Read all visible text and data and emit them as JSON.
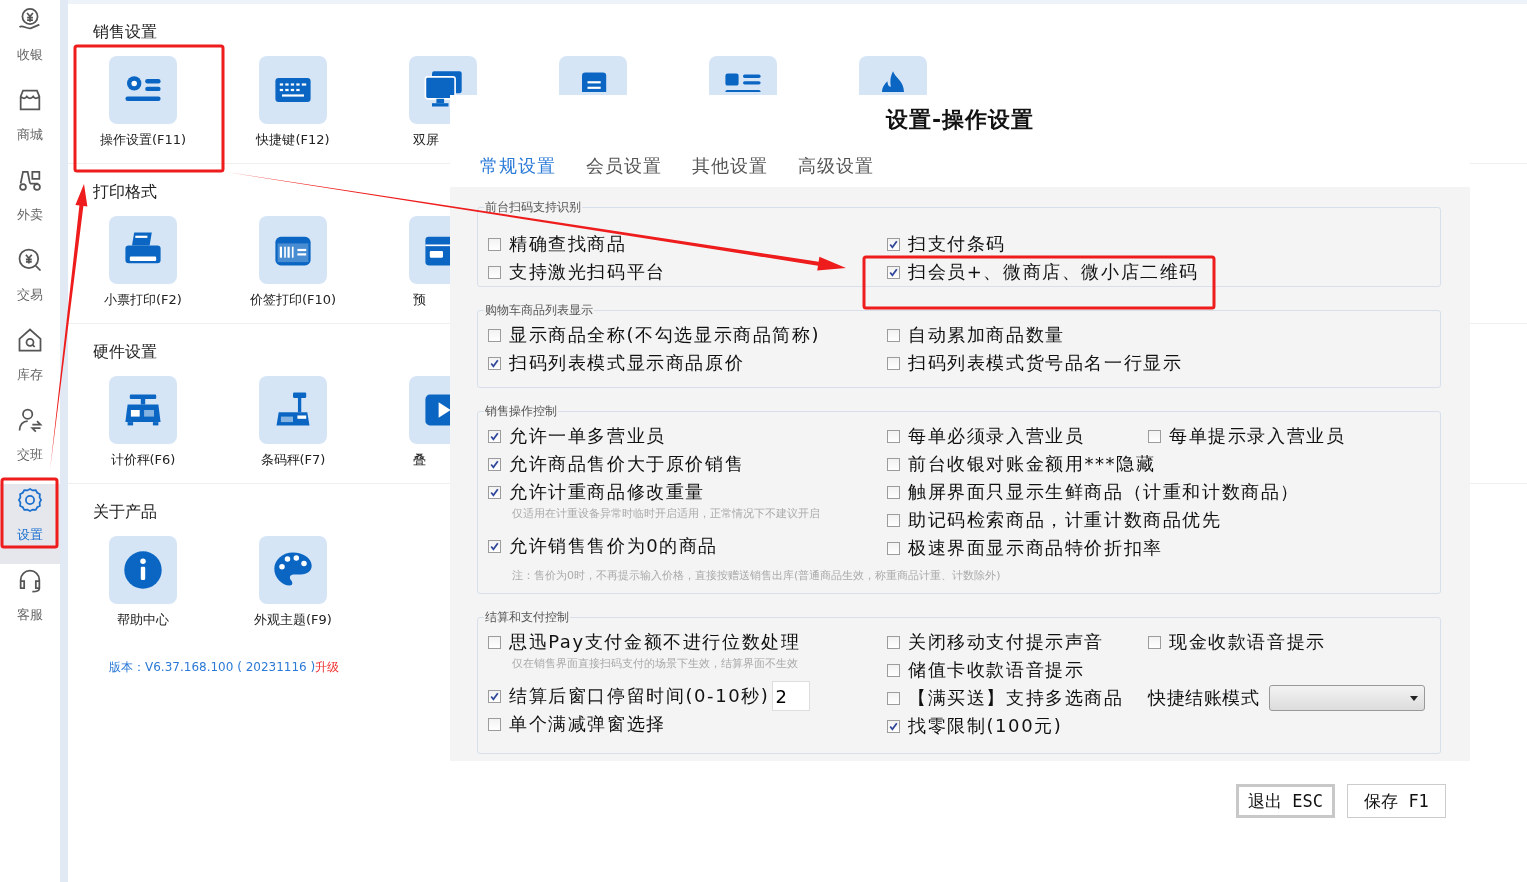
{
  "sidebar": {
    "items": [
      {
        "label": "收银",
        "selected": false
      },
      {
        "label": "商城",
        "selected": false
      },
      {
        "label": "外卖",
        "selected": false
      },
      {
        "label": "交易",
        "selected": false
      },
      {
        "label": "库存",
        "selected": false
      },
      {
        "label": "交班",
        "selected": false
      },
      {
        "label": "设置",
        "selected": true
      },
      {
        "label": "客服",
        "selected": false
      }
    ]
  },
  "sections": [
    {
      "title": "销售设置",
      "tiles": [
        {
          "kind": "labelled",
          "label": "操作设置(F11)"
        },
        {
          "kind": "labelled",
          "label": "快捷键(F12)"
        },
        {
          "kind": "labelled",
          "label": "双屏",
          "cut": true
        },
        {
          "kind": "covered"
        },
        {
          "kind": "covered"
        },
        {
          "kind": "covered"
        }
      ]
    },
    {
      "title": "打印格式",
      "tiles": [
        {
          "kind": "labelled",
          "label": "小票打印(F2)"
        },
        {
          "kind": "labelled",
          "label": "价签打印(F10)"
        },
        {
          "kind": "labelled",
          "label": "预",
          "cut": true
        }
      ]
    },
    {
      "title": "硬件设置",
      "tiles": [
        {
          "kind": "labelled",
          "label": "计价秤(F6)"
        },
        {
          "kind": "labelled",
          "label": "条码秤(F7)"
        },
        {
          "kind": "labelled",
          "label": "叠",
          "cut": true
        }
      ]
    },
    {
      "title": "关于产品",
      "tiles": [
        {
          "kind": "labelled",
          "label": "帮助中心"
        },
        {
          "kind": "labelled",
          "label": "外观主题(F9)"
        }
      ]
    }
  ],
  "version": {
    "text": "版本：V6.37.168.100 ( 20231116 )",
    "link": "升级"
  },
  "dialog": {
    "title": "设置-操作设置",
    "tabs": [
      {
        "label": "常规设置",
        "selected": true
      },
      {
        "label": "会员设置",
        "selected": false
      },
      {
        "label": "其他设置",
        "selected": false
      },
      {
        "label": "高级设置",
        "selected": false
      }
    ],
    "groups": [
      {
        "legend": "前台扫码支持识别",
        "left": [
          {
            "kind": "options",
            "items": [
              {
                "kind": "checkbox",
                "label": "精确查找商品",
                "checked": false
              }
            ]
          },
          {
            "kind": "options",
            "items": [
              {
                "kind": "checkbox",
                "label": "支持激光扫码平台",
                "checked": false
              }
            ]
          }
        ],
        "right": [
          {
            "kind": "options",
            "items": [
              {
                "kind": "checkbox",
                "label": "扫支付条码",
                "checked": true
              }
            ]
          },
          {
            "kind": "options",
            "items": [
              {
                "kind": "checkbox",
                "label": "扫会员+、微商店、微小店二维码",
                "checked": true
              }
            ]
          }
        ]
      },
      {
        "legend": "购物车商品列表显示",
        "left": [
          {
            "kind": "options",
            "items": [
              {
                "kind": "checkbox",
                "label": "显示商品全称(不勾选显示商品简称)",
                "checked": false
              }
            ]
          },
          {
            "kind": "options",
            "items": [
              {
                "kind": "checkbox",
                "label": "扫码列表模式显示商品原价",
                "checked": true
              }
            ]
          }
        ],
        "right": [
          {
            "kind": "options",
            "items": [
              {
                "kind": "checkbox",
                "label": "自动累加商品数量",
                "checked": false
              }
            ]
          },
          {
            "kind": "options",
            "items": [
              {
                "kind": "checkbox",
                "label": "扫码列表模式货号品名一行显示",
                "checked": false
              }
            ]
          }
        ]
      },
      {
        "legend": "销售操作控制",
        "left": [
          {
            "kind": "options",
            "items": [
              {
                "kind": "checkbox",
                "label": "允许一单多营业员",
                "checked": true
              }
            ]
          },
          {
            "kind": "options",
            "items": [
              {
                "kind": "checkbox",
                "label": "允许商品售价大于原价销售",
                "checked": true
              }
            ]
          },
          {
            "kind": "options",
            "items": [
              {
                "kind": "checkbox",
                "label": "允许计重商品修改重量",
                "checked": true
              }
            ]
          },
          {
            "kind": "hint",
            "text": "仅适用在计重设备异常时临时开启适用，正常情况下不建议开启"
          },
          {
            "kind": "options",
            "items": [
              {
                "kind": "checkbox",
                "label": "允许销售售价为0的商品",
                "checked": true
              }
            ]
          }
        ],
        "right": [
          {
            "kind": "options",
            "items": [
              {
                "kind": "checkbox",
                "label": "每单必须录入营业员",
                "checked": false
              },
              {
                "kind": "checkbox",
                "label": "每单提示录入营业员",
                "checked": false
              }
            ]
          },
          {
            "kind": "options",
            "items": [
              {
                "kind": "checkbox",
                "label": "前台收银对账金额用***隐藏",
                "checked": false
              }
            ]
          },
          {
            "kind": "options",
            "items": [
              {
                "kind": "checkbox",
                "label": "触屏界面只显示生鲜商品（计重和计数商品）",
                "checked": false
              }
            ]
          },
          {
            "kind": "options",
            "items": [
              {
                "kind": "checkbox",
                "label": "助记码检索商品，计重计数商品优先",
                "checked": false
              }
            ]
          },
          {
            "kind": "options",
            "items": [
              {
                "kind": "checkbox",
                "label": "极速界面显示商品特价折扣率",
                "checked": false
              }
            ]
          }
        ],
        "note": "注：售价为0时，不再提示输入价格，直接按赠送销售出库(普通商品生效，称重商品计重、计数除外)"
      },
      {
        "legend": "结算和支付控制",
        "left": [
          {
            "kind": "options",
            "items": [
              {
                "kind": "checkbox",
                "label": "思迅Pay支付金额不进行位数处理",
                "checked": false
              }
            ]
          },
          {
            "kind": "hint",
            "text": "仅在销售界面直接扫码支付的场景下生效，结算界面不生效"
          },
          {
            "kind": "options",
            "items": [
              {
                "kind": "checkbox",
                "label": "结算后窗口停留时间(0-10秒)",
                "checked": true,
                "value": "2"
              }
            ]
          },
          {
            "kind": "options",
            "items": [
              {
                "kind": "checkbox",
                "label": "单个满减弹窗选择",
                "checked": false
              }
            ]
          }
        ],
        "right": [
          {
            "kind": "options",
            "items": [
              {
                "kind": "checkbox",
                "label": "关闭移动支付提示声音",
                "checked": false
              },
              {
                "kind": "checkbox",
                "label": "现金收款语音提示",
                "checked": false
              }
            ]
          },
          {
            "kind": "options",
            "items": [
              {
                "kind": "checkbox",
                "label": "储值卡收款语音提示",
                "checked": false
              }
            ]
          },
          {
            "kind": "options",
            "items": [
              {
                "kind": "checkbox",
                "label": "【满买送】支持多选商品",
                "checked": false
              },
              {
                "kind": "select",
                "label": "快捷结账模式"
              }
            ]
          },
          {
            "kind": "options",
            "items": [
              {
                "kind": "checkbox",
                "label": "找零限制(100元)",
                "checked": true
              }
            ]
          }
        ]
      }
    ],
    "buttons": [
      {
        "label": "退出 ESC",
        "default": true
      },
      {
        "label": "保存 F1",
        "default": false
      }
    ]
  }
}
